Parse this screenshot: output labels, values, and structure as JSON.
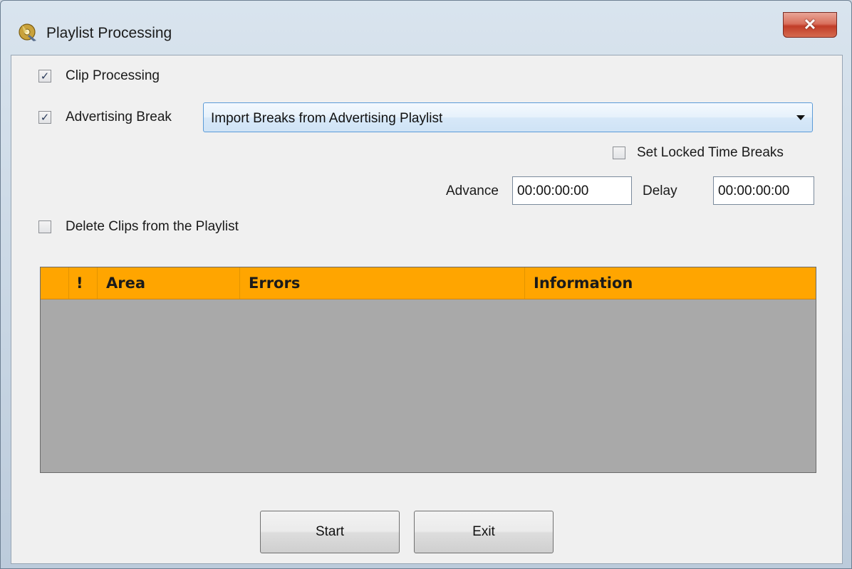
{
  "window": {
    "title": "Playlist Processing",
    "close_glyph": "✕"
  },
  "options": {
    "clip_processing": {
      "label": "Clip Processing",
      "checked": true
    },
    "advertising_break": {
      "label": "Advertising Break",
      "checked": true
    },
    "break_mode": {
      "selected": "Import Breaks from  Advertising Playlist"
    },
    "set_locked": {
      "label": "Set Locked Time Breaks",
      "checked": false
    },
    "advance": {
      "label": "Advance",
      "value": "00:00:00:00"
    },
    "delay": {
      "label": "Delay",
      "value": "00:00:00:00"
    },
    "delete_clips": {
      "label": "Delete Clips from the Playlist",
      "checked": false
    }
  },
  "grid": {
    "columns": [
      "",
      "!",
      "Area",
      "Errors",
      "Information"
    ],
    "rows": []
  },
  "buttons": {
    "start": "Start",
    "exit": "Exit"
  },
  "colors": {
    "grid_header": "#ffa500",
    "grid_body": "#a9a9a9",
    "close": "#c13d28"
  },
  "icons": {
    "title": "playlist-processing-icon",
    "check": "checkmark-icon",
    "dropdown": "chevron-down-icon"
  }
}
